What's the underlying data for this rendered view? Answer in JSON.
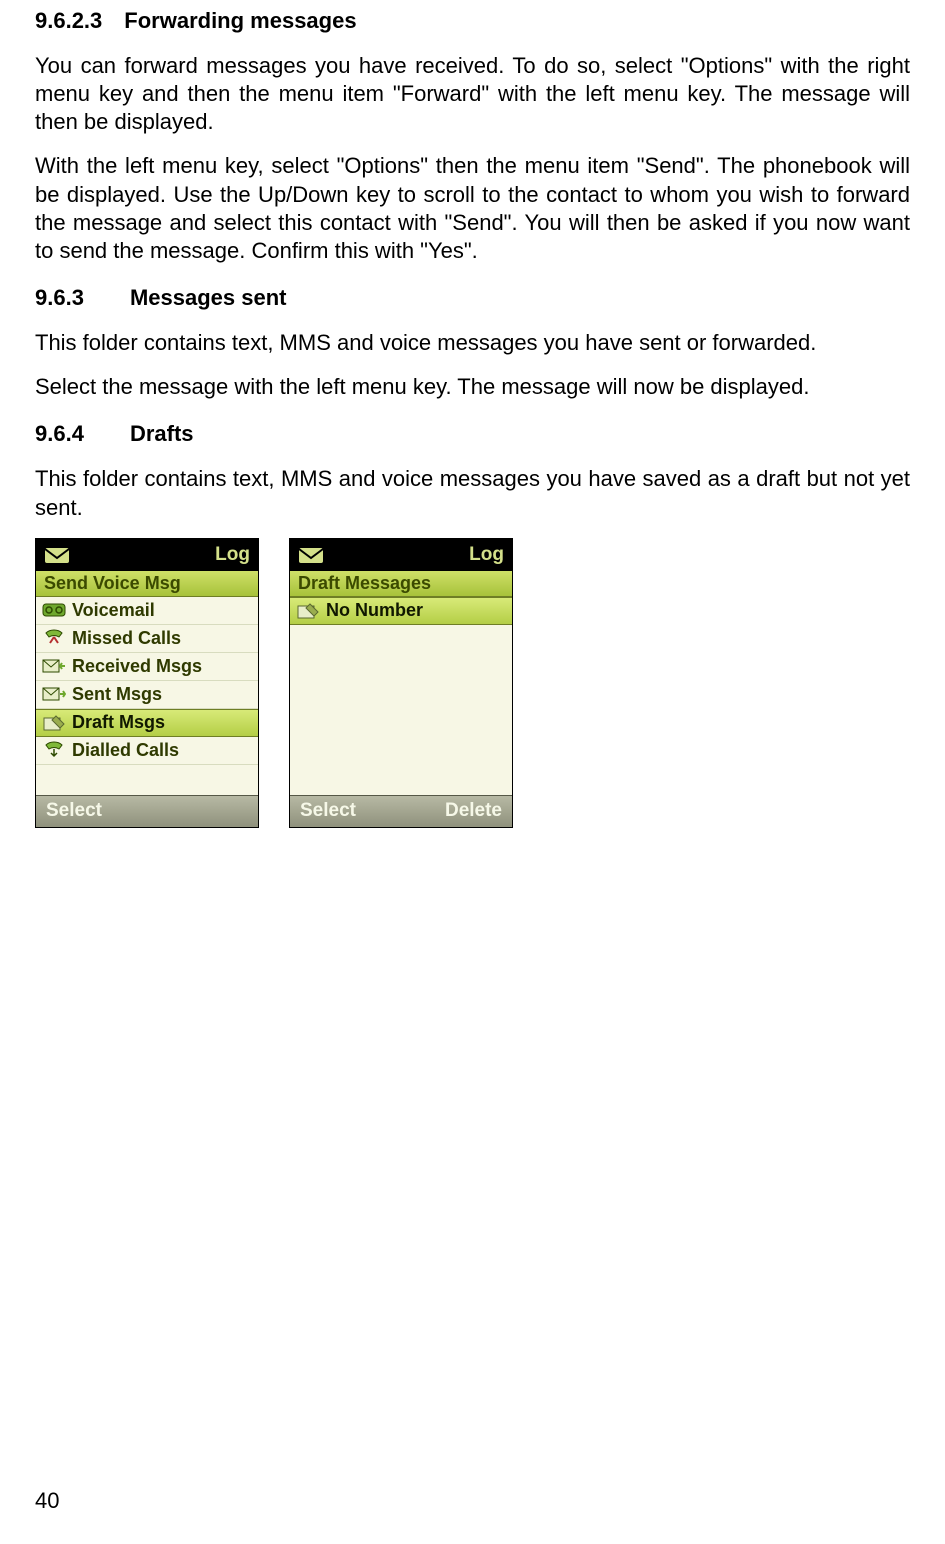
{
  "sections": {
    "s1": {
      "num": "9.6.2.3",
      "title": "Forwarding messages"
    },
    "s2": {
      "num": "9.6.3",
      "title": "Messages sent"
    },
    "s3": {
      "num": "9.6.4",
      "title": "Drafts"
    }
  },
  "paragraphs": {
    "p1": "You can forward messages you have received. To do so, select  \"Options\" with the right menu key and then the menu item \"Forward\" with the left menu key. The message will then be displayed.",
    "p2": "With the left menu key, select \"Options\" then the menu item \"Send\". The phonebook will be displayed. Use the Up/Down key to scroll to the contact to whom you wish to forward the message and select this contact with \"Send\". You will then be asked if you now want to send the message. Confirm this with \"Yes\".",
    "p3": "This folder contains text, MMS and voice messages you have sent or forwarded.",
    "p4": "Select the message with the left menu key. The message will now be displayed.",
    "p5": "This folder contains text, MMS and voice messages you have saved as a draft but not yet sent."
  },
  "screen1": {
    "title": "Log",
    "band": "Send Voice Msg",
    "items": [
      {
        "label": "Voicemail",
        "icon": "voicemail-icon"
      },
      {
        "label": "Missed Calls",
        "icon": "missed-call-icon"
      },
      {
        "label": "Received Msgs",
        "icon": "received-msg-icon"
      },
      {
        "label": "Sent Msgs",
        "icon": "sent-msg-icon"
      },
      {
        "label": "Draft Msgs",
        "icon": "draft-msg-icon",
        "selected": true
      },
      {
        "label": "Dialled Calls",
        "icon": "dialled-call-icon"
      }
    ],
    "soft_left": "Select",
    "soft_right": ""
  },
  "screen2": {
    "title": "Log",
    "band": "Draft Messages",
    "items": [
      {
        "label": "No Number",
        "icon": "draft-msg-icon",
        "selected": true
      }
    ],
    "soft_left": "Select",
    "soft_right": "Delete"
  },
  "page_number": "40"
}
